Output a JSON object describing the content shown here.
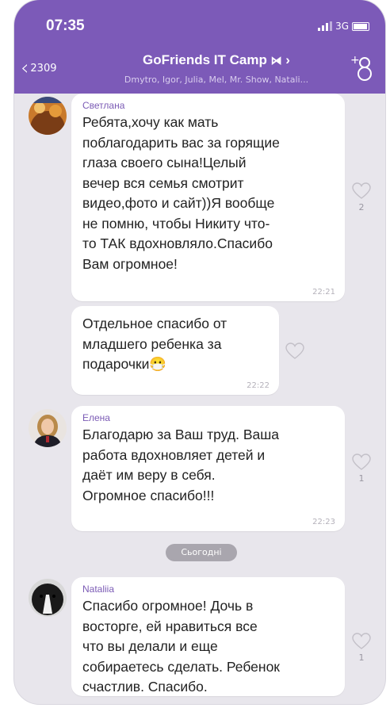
{
  "status_bar": {
    "time": "07:35",
    "network": "3G"
  },
  "header": {
    "back_count": "2309",
    "title": "GoFriends IT Camp",
    "title_suffix": "⋪ ›",
    "subtitle": "Dmytro, Igor, Julia, Mel, Mr. Show, Natali..."
  },
  "messages": [
    {
      "sender": "Светлана",
      "text": "Ребята,хочу как мать\nпоблагодарить вас за горящие\nглаза своего сына!Целый\nвечер вся семья смотрит\nвидео,фото и сайт))Я вообще\nне помню, чтобы Никиту что-\nто ТАК вдохновляло.Спасибо\nВам огромное!",
      "time": "22:21",
      "likes": "2"
    },
    {
      "text": "Отдельное спасибо от\nмладшего ребенка за\nподарочки😷",
      "time": "22:22",
      "likes": ""
    },
    {
      "sender": "Елена",
      "text": "Благодарю за Ваш труд. Ваша\nработа вдохновляет детей и\nдаёт им веру в себя.\nОгромное спасибо!!!",
      "time": "22:23",
      "likes": "1"
    },
    {
      "sender": "Nataliia",
      "text": "Спасибо огромное! Дочь в\nвосторге,  ей нравиться все\nчто вы делали и еще\nсобираетесь сделать. Ребенок\nсчастлив. Спасибо.",
      "time": "",
      "likes": "1"
    }
  ],
  "date_divider": "Сьогодні",
  "colors": {
    "header": "#7c5ab8",
    "sender": "#7b5bb5",
    "background": "#e8e6ec"
  }
}
